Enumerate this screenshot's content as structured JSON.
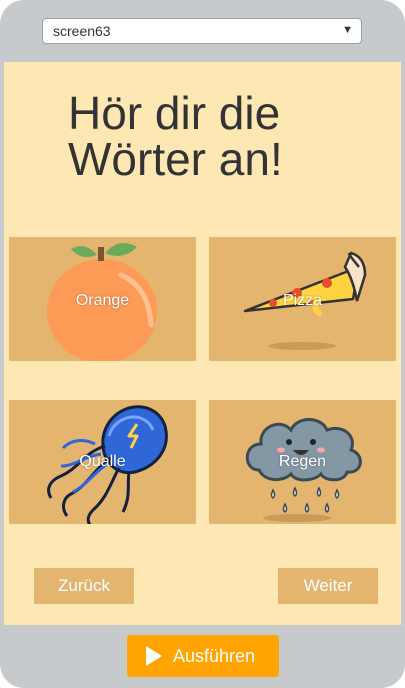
{
  "screen_select": {
    "value": "screen63"
  },
  "headline": "Hör dir die Wörter an!",
  "tiles": [
    {
      "label": "Orange",
      "icon": "orange-icon"
    },
    {
      "label": "Pizza",
      "icon": "pizza-icon"
    },
    {
      "label": "Qualle",
      "icon": "jellyfish-icon"
    },
    {
      "label": "Regen",
      "icon": "rain-cloud-icon"
    }
  ],
  "nav": {
    "back": "Zurück",
    "next": "Weiter"
  },
  "run_button": {
    "label": "Ausführen",
    "icon": "play-icon"
  },
  "colors": {
    "screen_bg": "#fde8b4",
    "tile_bg": "#e3b56f",
    "run_button": "#ffa400",
    "frame": "#c6cacd"
  }
}
